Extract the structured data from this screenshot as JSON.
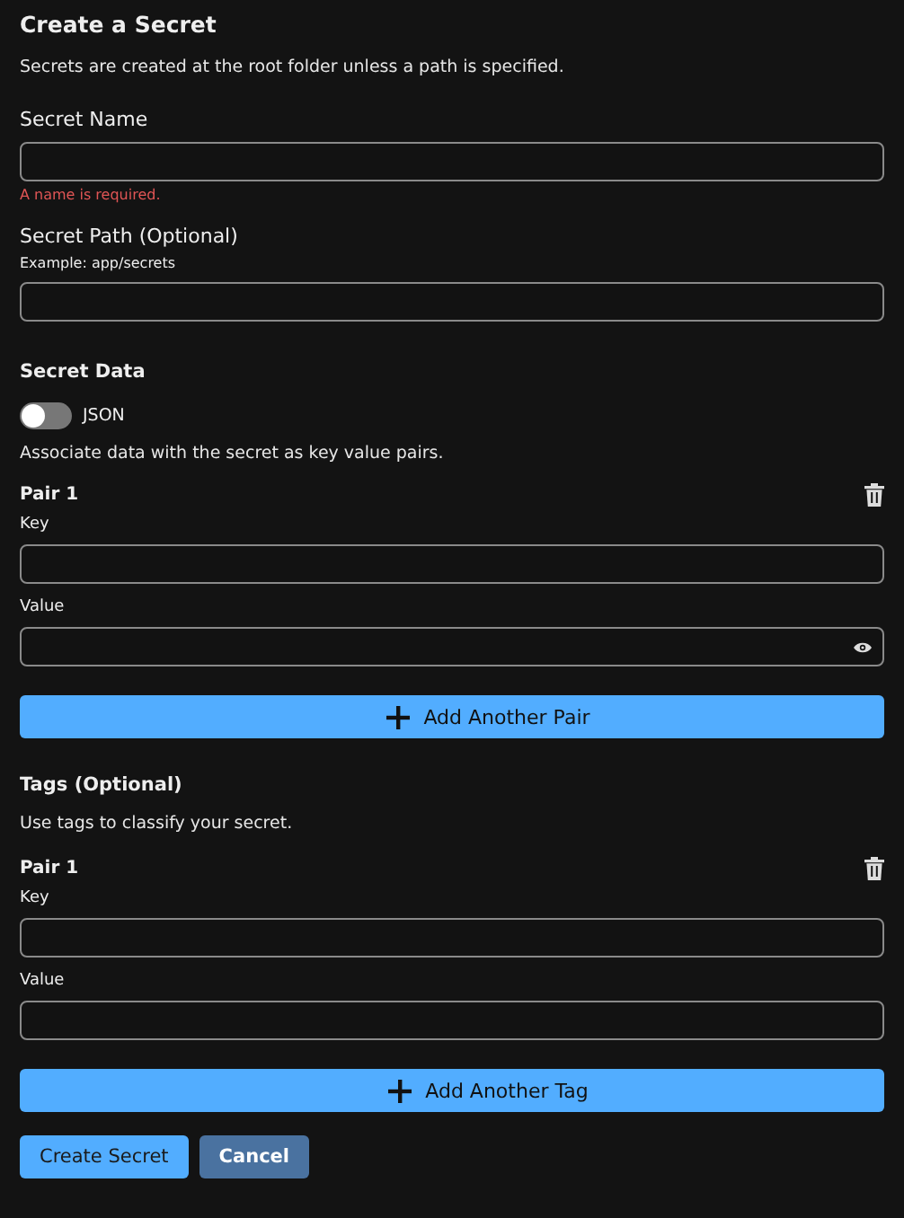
{
  "title": "Create a Secret",
  "description": "Secrets are created at the root folder unless a path is specified.",
  "secret_name": {
    "label": "Secret Name",
    "error": "A name is required."
  },
  "secret_path": {
    "label": "Secret Path (Optional)",
    "hint": "Example: app/secrets"
  },
  "secret_data": {
    "heading": "Secret Data",
    "json_toggle": {
      "label": "JSON",
      "on": false
    },
    "description": "Associate data with the secret as key value pairs.",
    "pairs": [
      {
        "title": "Pair 1",
        "key_label": "Key",
        "value_label": "Value",
        "reveal_toggle": true
      }
    ],
    "add_button": "Add Another Pair"
  },
  "tags": {
    "heading": "Tags (Optional)",
    "description": "Use tags to classify your secret.",
    "pairs": [
      {
        "title": "Pair 1",
        "key_label": "Key",
        "value_label": "Value",
        "reveal_toggle": false
      }
    ],
    "add_button": "Add Another Tag"
  },
  "buttons": [
    {
      "label": "Create Secret",
      "kind": "primary"
    },
    {
      "label": "Cancel",
      "kind": "secondary"
    }
  ]
}
